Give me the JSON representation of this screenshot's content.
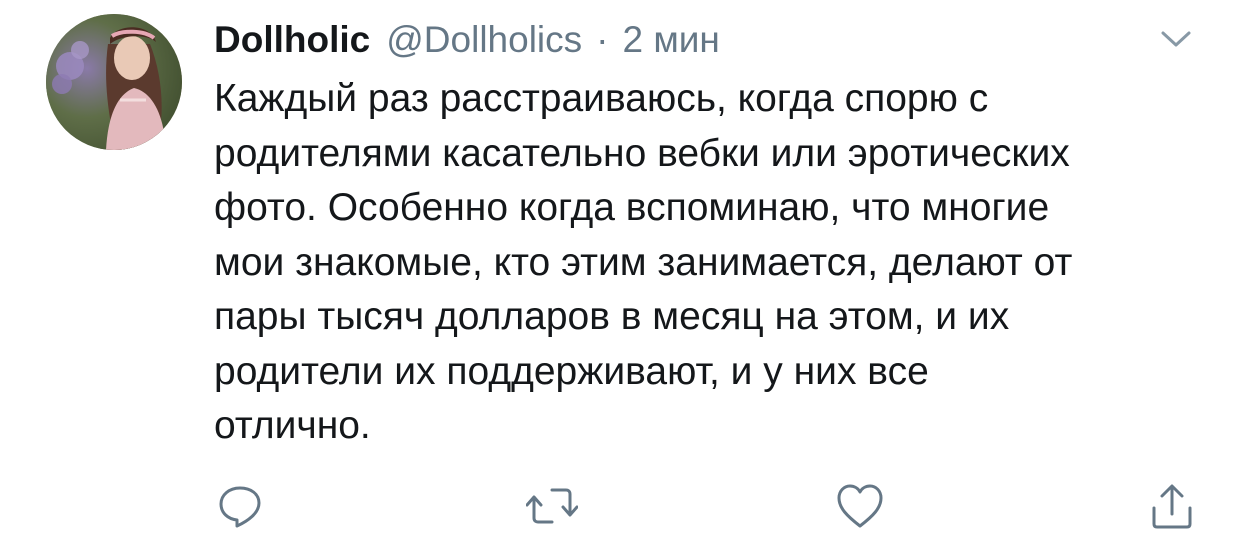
{
  "tweet": {
    "display_name": "Dollholic",
    "handle": "@Dollholics",
    "separator": "·",
    "time": "2 мин",
    "text": "Каждый раз расстраиваюсь, когда спорю с\nродителями касательно вебки или эротических\nфото. Особенно когда вспоминаю, что многие\nмои знакомые, кто этим занимается, делают от\nпары тысяч долларов в месяц на этом, и их\nродители их поддерживают, и у них все\nотлично."
  },
  "icons": {
    "more": "chevron-down-icon",
    "reply": "reply-icon",
    "retweet": "retweet-icon",
    "like": "heart-icon",
    "share": "share-icon"
  },
  "colors": {
    "text": "#14171a",
    "secondary": "#657786"
  }
}
